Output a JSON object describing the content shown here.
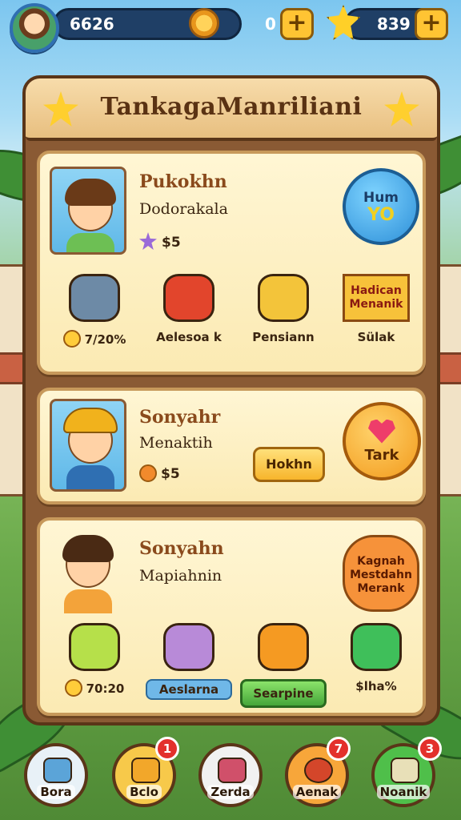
{
  "hud": {
    "coins": "6626",
    "middle_value": "0",
    "stars": "839",
    "plus_label": "+"
  },
  "panel": {
    "title": "TankagaManriliani"
  },
  "cards": [
    {
      "name": "Pukokhn",
      "subtitle": "Dodorakala",
      "stat": "$5",
      "action_badge": [
        "Hum",
        "YO"
      ],
      "items": [
        {
          "label": "7/20%",
          "icon": "seal-icon"
        },
        {
          "label": "Aelesoa k",
          "icon": "fruit-icon"
        },
        {
          "label": "Pensiann",
          "icon": "coins-heart-icon"
        },
        {
          "label": "Sülak",
          "icon": "sign-icon"
        }
      ],
      "sign_text": "Hadican Menanik"
    },
    {
      "name": "Sonyahr",
      "subtitle": "Menaktih",
      "stat": "$5",
      "button_label": "Hokhn",
      "action_label": "Tark"
    },
    {
      "name": "Sonyahn",
      "subtitle": "Mapiahnin",
      "badge_text": "Kagnah Mestdahn Merank",
      "items": [
        {
          "label": "70:20",
          "icon": "cat-icon"
        },
        {
          "label": "Aeslarna",
          "icon": "cake-icon"
        },
        {
          "label": "Searpine",
          "icon": "orange-icon"
        },
        {
          "label": "$lha%",
          "icon": "gem-icon"
        }
      ]
    }
  ],
  "nav": [
    {
      "label": "Bora",
      "badge": ""
    },
    {
      "label": "Bclo",
      "badge": "1"
    },
    {
      "label": "Zerda",
      "badge": ""
    },
    {
      "label": "Aenak",
      "badge": "7"
    },
    {
      "label": "Noanik",
      "badge": "3"
    }
  ],
  "colors": {
    "panel_wood": "#8a5a34",
    "card_fill": "#fff6d4",
    "hud_bar": "#1f3f66",
    "accent_gold": "#ffc433"
  }
}
